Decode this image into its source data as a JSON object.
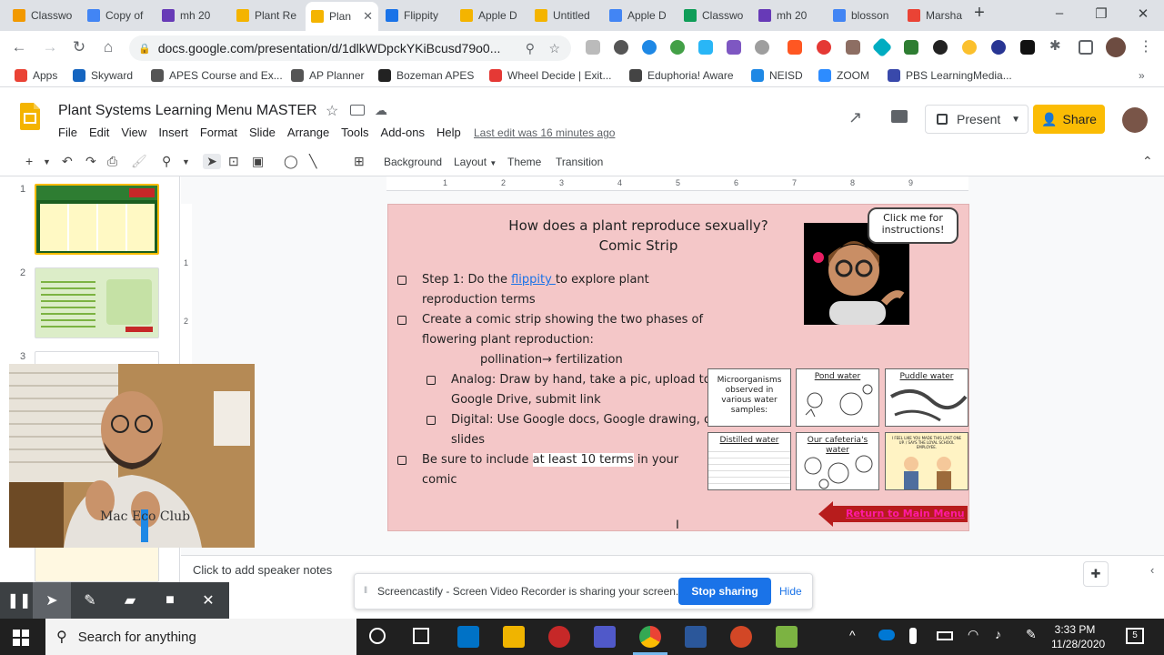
{
  "browser": {
    "tabs": [
      {
        "label": "Classwo",
        "color": "#f29900"
      },
      {
        "label": "Copy of",
        "color": "#4285f4"
      },
      {
        "label": "mh 20",
        "color": "#673ab7"
      },
      {
        "label": "Plant Re",
        "color": "#f4b400"
      },
      {
        "label": "Plan",
        "color": "#f4b400",
        "active": true
      },
      {
        "label": "Flippity",
        "color": "#1a73e8"
      },
      {
        "label": "Apple D",
        "color": "#f4b400"
      },
      {
        "label": "Untitled",
        "color": "#f4b400"
      },
      {
        "label": "Apple D",
        "color": "#4285f4"
      },
      {
        "label": "Classwo",
        "color": "#0f9d58"
      },
      {
        "label": "mh 20",
        "color": "#673ab7"
      },
      {
        "label": "blosson",
        "color": "#4285f4"
      },
      {
        "label": "Marsha",
        "color": "#ea4335"
      }
    ],
    "new_tab": "+",
    "url": "docs.google.com/presentation/d/1dlkWDpckYKiBcusd79o0...",
    "bookmarks": [
      {
        "label": "Apps",
        "color": "#ea4335"
      },
      {
        "label": "Skyward",
        "color": "#1565c0"
      },
      {
        "label": "APES Course and Ex...",
        "color": "#555"
      },
      {
        "label": "AP Planner",
        "color": "#555"
      },
      {
        "label": "Bozeman APES",
        "color": "#222"
      },
      {
        "label": "Wheel Decide | Exit...",
        "color": "#e53935"
      },
      {
        "label": "Eduphoria! Aware",
        "color": "#444"
      },
      {
        "label": "NEISD",
        "color": "#1e88e5"
      },
      {
        "label": "ZOOM",
        "color": "#2d8cff"
      },
      {
        "label": "PBS LearningMedia...",
        "color": "#3949ab"
      }
    ]
  },
  "slides_app": {
    "title": "Plant Systems Learning Menu MASTER",
    "menu": [
      "File",
      "Edit",
      "View",
      "Insert",
      "Format",
      "Slide",
      "Arrange",
      "Tools",
      "Add-ons",
      "Help"
    ],
    "last_edit": "Last edit was 16 minutes ago",
    "present_label": "Present",
    "share_label": "Share",
    "toolbar": {
      "background": "Background",
      "layout": "Layout",
      "theme": "Theme",
      "transition": "Transition"
    },
    "thumbnail_numbers": [
      "1",
      "2",
      "3"
    ],
    "ruler_numbers": [
      "1",
      "2",
      "3",
      "4",
      "5",
      "6",
      "7",
      "8",
      "9"
    ],
    "vruler_numbers": [
      "1",
      "2"
    ],
    "speaker_notes_placeholder": "Click to add speaker notes"
  },
  "slide": {
    "title_line1": "How does a plant reproduce sexually?",
    "title_line2": "Comic Strip",
    "step1_prefix": "Step 1: Do the ",
    "step1_link": "flippity ",
    "step1_suffix": "to explore plant",
    "step1_line2": "reproduction terms",
    "step2_line1": "Create a comic strip showing the two phases of",
    "step2_line2": "flowering plant reproduction:",
    "step2_line3": "pollination→ fertilization",
    "analog_line1": "Analog: Draw by hand, take a pic, upload to",
    "analog_line2": "Google Drive, submit link",
    "digital_line1": "Digital: Use Google docs, Google drawing, or",
    "digital_line2": "slides",
    "step3_prefix": "Be sure to include ",
    "step3_highlight": "at least 10 terms",
    "step3_suffix": " in your",
    "step3_line2": "comic",
    "bubble_text": "Click me for instructions!",
    "comic_panels": [
      {
        "title": "Microorganisms observed in various water samples:"
      },
      {
        "title": "Pond water"
      },
      {
        "title": "Puddle water"
      },
      {
        "title": "Distilled water"
      },
      {
        "title": "Our cafeteria's water"
      },
      {
        "title": "I FEEL LIKE YOU MADE THIS LAST ONE UP. / SAYS THE LOYAL SCHOOL EMPLOYEE."
      }
    ],
    "return_label": "Return to Main Menu"
  },
  "screencastify": {
    "message": "Screencastify - Screen Video Recorder is sharing your screen.",
    "stop_label": "Stop sharing",
    "hide_label": "Hide"
  },
  "taskbar": {
    "search_placeholder": "Search for anything",
    "time": "3:33 PM",
    "date": "11/28/2020",
    "notification_count": "5"
  },
  "colors": {
    "slide_background": "#f4c7c8",
    "share_button": "#fbbc04",
    "stop_button": "#1a73e8",
    "link": "#1a73e8",
    "return_arrow": "#b71c1c",
    "return_text": "#ff1aa3"
  }
}
